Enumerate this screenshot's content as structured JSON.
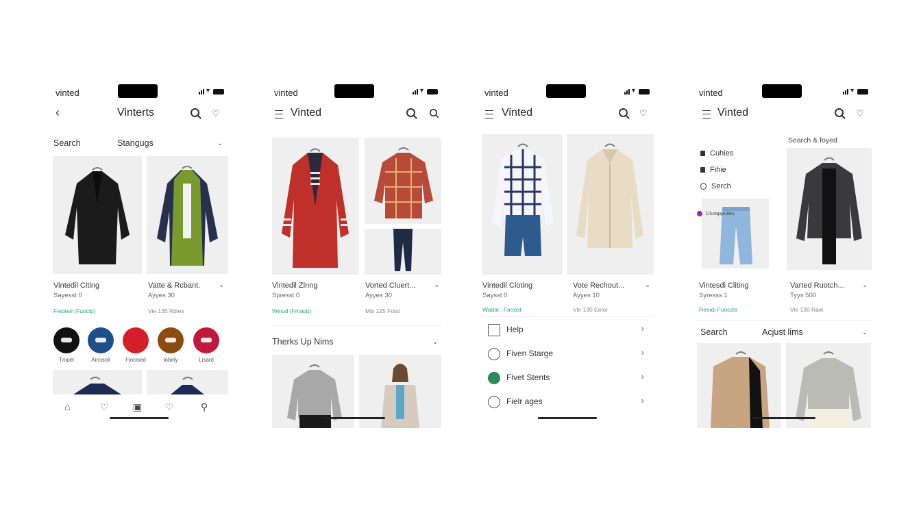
{
  "colors": {
    "accent_green": "#2aa28a",
    "home_indicator": "#222222",
    "notch": "#000000"
  },
  "phone1": {
    "carrier": "vinted",
    "title": "Vinterts",
    "search_label": "Search",
    "filter_label": "Stangugs",
    "products": [
      {
        "name": "Vintedil Clting",
        "meta": "Sayesst 0",
        "status": "Fiedeal (Fuocip)"
      },
      {
        "name": "Vatte & Rcbant.",
        "meta": "Ayyes 30",
        "status": "Vie 135 Rdies"
      }
    ],
    "categories": [
      "Tnipel",
      "Aircisoil",
      "Fiocised",
      "Iobely",
      "Lisard"
    ],
    "tab_icons": [
      "home-icon",
      "heart-icon",
      "sell-icon",
      "heart-outline-icon",
      "search-icon"
    ]
  },
  "phone2": {
    "carrier": "vinted",
    "title": "Vinted",
    "products": [
      {
        "name": "Vintedil Zlnng",
        "meta": "Spresst 0",
        "status": "Wesal (Fmatip)"
      },
      {
        "name": "Vorted Cluert...",
        "meta": "Ayyes 30",
        "status": "Mis 125 Foist"
      }
    ],
    "section_title": "Therks Up Nims"
  },
  "phone3": {
    "carrier": "vinted",
    "title": "Vinted",
    "products": [
      {
        "name": "Vintedil Cloting",
        "meta": "Saysst 0",
        "status": "Wadal : Faoost"
      },
      {
        "name": "Vote Rechout...",
        "meta": "Ayyes 10",
        "status": "Vie 130 Eelor"
      }
    ],
    "menu": [
      {
        "label": "Help",
        "icon": "edit-icon"
      },
      {
        "label": "Fiven Starge",
        "icon": "badge-icon"
      },
      {
        "label": "Fivet Stents",
        "icon": "leaf-icon"
      },
      {
        "label": "Fielr ages",
        "icon": "gift-icon"
      }
    ]
  },
  "phone4": {
    "carrier": "vinted",
    "title": "Vinted",
    "search_top": "Search & foyed",
    "side_menu": [
      "Cuhies",
      "Fihie",
      "Serch"
    ],
    "tag_label": "Clurappuiles",
    "products": [
      {
        "name": "Vintesdi Cliting",
        "meta": "Syresss 1",
        "status": "Reeidi Fuocdis"
      },
      {
        "name": "Varted Ruotch...",
        "meta": "Tyys 500",
        "status": "Vie 130 Raie"
      }
    ],
    "search_label": "Search",
    "adjust_label": "Acjust lims"
  }
}
